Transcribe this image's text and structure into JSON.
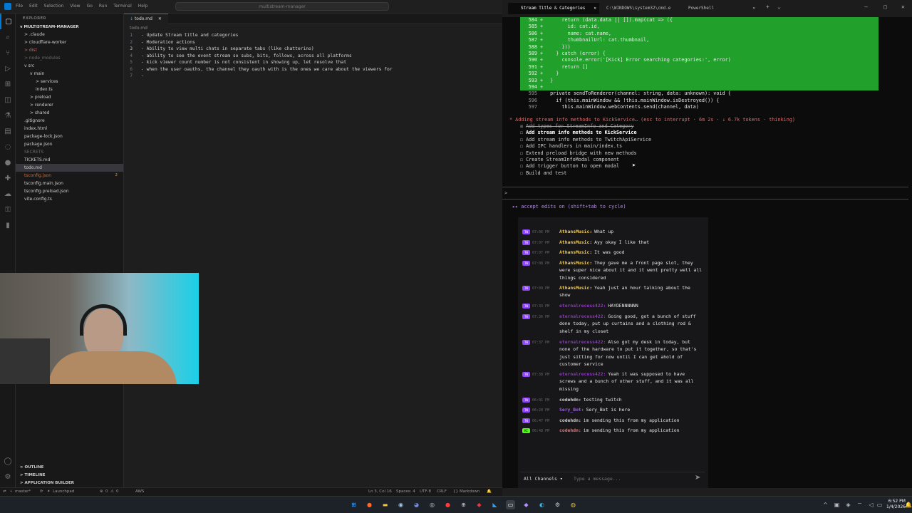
{
  "vscode": {
    "menus": [
      "File",
      "Edit",
      "Selection",
      "View",
      "Go",
      "Run",
      "Terminal",
      "Help"
    ],
    "command_center": "multistream-manager",
    "explorer_title": "EXPLORER",
    "project_name": "MULTISTREAM-MANAGER",
    "tree": [
      {
        "label": "> .claude",
        "indent": 1,
        "color": "#cccccc"
      },
      {
        "label": "> cloudflare-worker",
        "indent": 1,
        "color": "#cccccc"
      },
      {
        "label": "> dist",
        "indent": 1,
        "color": "#c46a6a"
      },
      {
        "label": "> node_modules",
        "indent": 1,
        "color": "#6b6b6b"
      },
      {
        "label": "v src",
        "indent": 1,
        "color": "#cccccc"
      },
      {
        "label": "v main",
        "indent": 2,
        "color": "#cccccc"
      },
      {
        "label": "> services",
        "indent": 3,
        "color": "#cccccc"
      },
      {
        "label": "index.ts",
        "indent": 3,
        "color": "#cccccc"
      },
      {
        "label": "> preload",
        "indent": 2,
        "color": "#cccccc"
      },
      {
        "label": "> renderer",
        "indent": 2,
        "color": "#cccccc"
      },
      {
        "label": "> shared",
        "indent": 2,
        "color": "#cccccc"
      },
      {
        "label": ".gitignore",
        "indent": 1,
        "color": "#cccccc"
      },
      {
        "label": "index.html",
        "indent": 1,
        "color": "#cccccc"
      },
      {
        "label": "package-lock.json",
        "indent": 1,
        "color": "#cccccc"
      },
      {
        "label": "package.json",
        "indent": 1,
        "color": "#cccccc"
      },
      {
        "label": "SECRETS",
        "indent": 1,
        "color": "#6b6b6b"
      },
      {
        "label": "TICKETS.md",
        "indent": 1,
        "color": "#cccccc"
      },
      {
        "label": "todo.md",
        "indent": 1,
        "color": "#cccccc",
        "selected": true
      },
      {
        "label": "tsconfig.json",
        "indent": 1,
        "color": "#c96a3c",
        "badge": "2"
      },
      {
        "label": "tsconfig.main.json",
        "indent": 1,
        "color": "#cccccc"
      },
      {
        "label": "tsconfig.preload.json",
        "indent": 1,
        "color": "#cccccc"
      },
      {
        "label": "vite.config.ts",
        "indent": 1,
        "color": "#cccccc"
      }
    ],
    "bottom_sections": [
      "OUTLINE",
      "TIMELINE",
      "APPLICATION BUILDER"
    ],
    "editor_tab": "todo.md",
    "breadcrumb": "todo.md",
    "lines": [
      "- Update Stream title and categories",
      "- Moderation actions",
      "- Ability to view multi chats in separate tabs (like chatterino)",
      "- ability to see the event stream so subs, bits, follows, across all platforms",
      "- kick viewer count number is not consistent in showing up, let resolve that",
      "- when the user oauths, the channel they oauth with is the ones we care about the viewers for",
      "-"
    ],
    "status_left": [
      "master*",
      "Launchpad",
      "0",
      "0",
      "AWS"
    ],
    "status_right": [
      "Ln 3, Col 16",
      "Spaces: 4",
      "UTF-8",
      "CRLF",
      "Markdown"
    ]
  },
  "terminal": {
    "tabs": [
      "Stream Title & Categories",
      "C:\\WINDOWS\\system32\\cmd.e",
      "PowerShell"
    ],
    "code_lines": [
      {
        "num": "584",
        "mark": "+",
        "text": "    return (data.data || []).map(cat => ({",
        "added": true
      },
      {
        "num": "585",
        "mark": "+",
        "text": "      id: cat.id,",
        "added": true
      },
      {
        "num": "586",
        "mark": "+",
        "text": "      name: cat.name,",
        "added": true
      },
      {
        "num": "587",
        "mark": "+",
        "text": "      thumbnailUrl: cat.thumbnail,",
        "added": true
      },
      {
        "num": "588",
        "mark": "+",
        "text": "    }))",
        "added": true
      },
      {
        "num": "589",
        "mark": "+",
        "text": "  } catch (error) {",
        "added": true
      },
      {
        "num": "590",
        "mark": "+",
        "text": "    console.error('[Kick] Error searching categories:', error)",
        "added": true
      },
      {
        "num": "591",
        "mark": "+",
        "text": "    return []",
        "added": true
      },
      {
        "num": "592",
        "mark": "+",
        "text": "  }",
        "added": true
      },
      {
        "num": "593",
        "mark": "+",
        "text": "}",
        "added": true
      },
      {
        "num": "594",
        "mark": "+",
        "text": "",
        "added": true
      },
      {
        "num": "595",
        "mark": " ",
        "text": "private sendToRenderer(channel: string, data: unknown): void {",
        "added": false
      },
      {
        "num": "596",
        "mark": " ",
        "text": "  if (this.mainWindow && !this.mainWindow.isDestroyed()) {",
        "added": false
      },
      {
        "num": "597",
        "mark": " ",
        "text": "    this.mainWindow.webContents.send(channel, data)",
        "added": false
      }
    ],
    "status_line": "* Adding stream info methods to KickService… (esc to interrupt · 6m 2s · ↓ 6.7k tokens · thinking)",
    "tasks": [
      {
        "box": "☒",
        "text": "Add types for StreamInfo and Category",
        "done": true
      },
      {
        "box": "☐",
        "text": "Add stream info methods to KickService",
        "current": true
      },
      {
        "box": "☐",
        "text": "Add stream info methods to TwitchApiService"
      },
      {
        "box": "☐",
        "text": "Add IPC handlers in main/index.ts"
      },
      {
        "box": "☐",
        "text": "Extend preload bridge with new methods"
      },
      {
        "box": "☐",
        "text": "Create StreamInfoModal component"
      },
      {
        "box": "☐",
        "text": "Add trigger button to open modal"
      },
      {
        "box": "☐",
        "text": "Build and test"
      }
    ],
    "prompt": ">",
    "accept_edits": "▸▸ accept edits on (shift+tab to cycle)"
  },
  "chat": {
    "messages": [
      {
        "platform": "TW",
        "time": "07:06 PM",
        "user": "AthansMusic:",
        "user_color": "#f2c94c",
        "text": "What up"
      },
      {
        "platform": "TW",
        "time": "07:07 PM",
        "user": "AthansMusic:",
        "user_color": "#f2c94c",
        "text": "Ayy okay I like that"
      },
      {
        "platform": "TW",
        "time": "07:07 PM",
        "user": "AthansMusic:",
        "user_color": "#f2c94c",
        "text": "It was good"
      },
      {
        "platform": "TW",
        "time": "07:08 PM",
        "user": "AthansMusic:",
        "user_color": "#f2c94c",
        "text": "They gave me a front page slot, they were super nice about it and it went pretty well all things considered"
      },
      {
        "platform": "TW",
        "time": "07:09 PM",
        "user": "AthansMusic:",
        "user_color": "#f2c94c",
        "text": "Yeah just an hour talking about the show"
      },
      {
        "platform": "TW",
        "time": "07:33 PM",
        "user": "eternalrecess422:",
        "user_color": "#8a3ab9",
        "text": "HAYDENNNNNN"
      },
      {
        "platform": "TW",
        "time": "07:36 PM",
        "user": "eternalrecess422:",
        "user_color": "#8a3ab9",
        "text": "Going good, got a bunch of stuff done today, put up curtains and a clothing rod & shelf in my closet"
      },
      {
        "platform": "TW",
        "time": "07:37 PM",
        "user": "eternalrecess422:",
        "user_color": "#8a3ab9",
        "text": "Also got my desk in today, but none of the hardware to put it together, so that's just sitting for now until I can get ahold of customer service"
      },
      {
        "platform": "TW",
        "time": "07:38 PM",
        "user": "eternalrecess422:",
        "user_color": "#8a3ab9",
        "text": "Yeah it was supposed to have screws and a bunch of other stuff, and it was all missing"
      },
      {
        "platform": "TW",
        "time": "06:01 PM",
        "user": "codehdn:",
        "user_color": "#d0d0d0",
        "text": "testing twitch"
      },
      {
        "platform": "TW",
        "time": "06:20 PM",
        "user": "Sery_Bot:",
        "user_color": "#9b5de5",
        "text": "Sery_Bot is here"
      },
      {
        "platform": "TW",
        "time": "06:47 PM",
        "user": "codehdn:",
        "user_color": "#d0d0d0",
        "text": "im sending this from my application"
      },
      {
        "platform": "KI",
        "time": "06:48 PM",
        "user": "codehdn:",
        "user_color": "#ff6b6b",
        "text": "im sending this from my application"
      }
    ],
    "channel_select": "All Channels",
    "message_placeholder": "Type a message..."
  },
  "taskbar": {
    "time": "6:52 PM",
    "date": "1/4/2026"
  }
}
